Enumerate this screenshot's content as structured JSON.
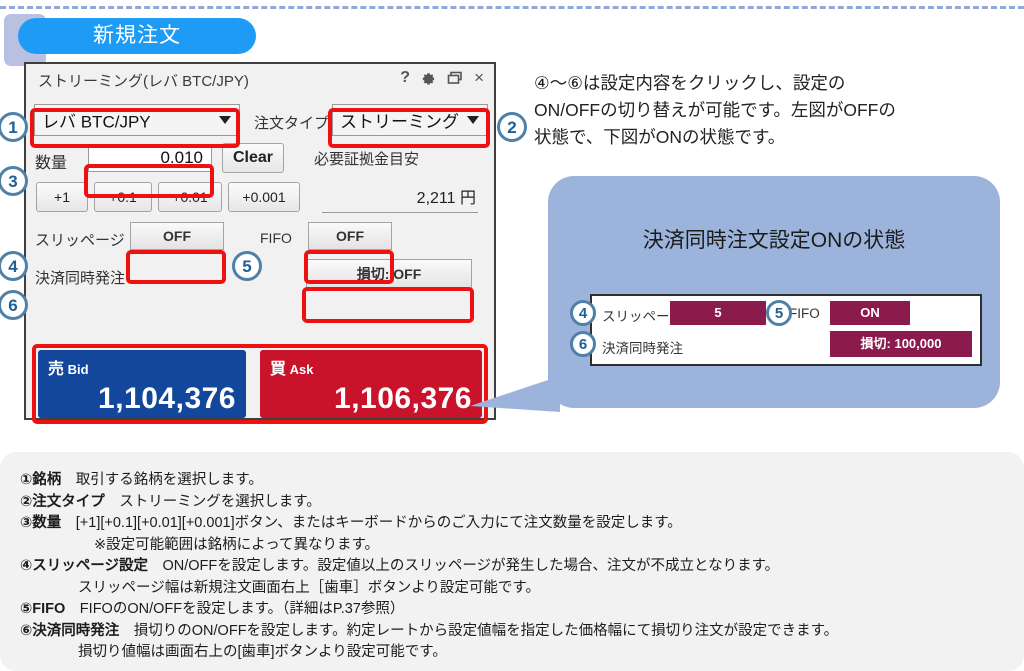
{
  "colors": {
    "accent_blue": "#1e9cf5",
    "bubble_blue": "#9cb4dc",
    "bid_blue": "#13479b",
    "ask_red": "#c9132b",
    "highlight_red": "#ee1111",
    "on_value_magenta": "#8c1b4d",
    "callout_circle_border": "#4f81a8",
    "dashed_rule": "#8fa8d8",
    "legend_bg": "#f2f2f2"
  },
  "section_tab": {
    "label": "新規注文"
  },
  "order_window": {
    "title": "ストリーミング(レバ BTC/JPY)",
    "titlebar_buttons": [
      {
        "name": "help-icon",
        "glyph": "?"
      },
      {
        "name": "gear-icon",
        "glyph": "⚙"
      },
      {
        "name": "restore-window-icon",
        "glyph": "❐"
      },
      {
        "name": "close-icon",
        "glyph": "×"
      }
    ],
    "symbol_select": {
      "value": "レバ BTC/JPY"
    },
    "order_type": {
      "label": "注文タイプ",
      "value": "ストリーミング"
    },
    "quantity": {
      "label": "数量",
      "value": "0.010",
      "clear_label": "Clear",
      "step_buttons": [
        "+1",
        "+0.1",
        "+0.01",
        "+0.001"
      ]
    },
    "margin": {
      "label": "必要証拠金目安",
      "value": "2,211",
      "unit": "円"
    },
    "slippage": {
      "label": "スリッページ",
      "value": "OFF"
    },
    "fifo": {
      "label": "FIFO",
      "value": "OFF"
    },
    "settle_simultaneous": {
      "label": "決済同時発注",
      "value": "損切: OFF"
    },
    "rates": {
      "bid": {
        "jp": "売",
        "en": "Bid",
        "price": "1,104,376"
      },
      "ask": {
        "jp": "買",
        "en": "Ask",
        "price": "1,106,376"
      }
    }
  },
  "callout_numbers": {
    "n1": "1",
    "n2": "2",
    "n3": "3",
    "n4": "4",
    "n5": "5",
    "n6": "6"
  },
  "description": {
    "line1": "④～⑥は設定内容をクリックし、設定の",
    "line2": "ON/OFFの切り替えが可能です。左図がOFFの",
    "line3": "状態で、下図がONの状態です。"
  },
  "bubble": {
    "title": "決済同時注文設定ONの状態",
    "on_panel": {
      "slippage": {
        "label": "スリッページ",
        "value": "5"
      },
      "fifo": {
        "label": "FIFO",
        "value": "ON"
      },
      "settle_simultaneous": {
        "label": "決済同時発注",
        "value": "損切: 100,000"
      },
      "numbers": {
        "n4": "4",
        "n5": "5",
        "n6": "6"
      }
    }
  },
  "legend": {
    "lines": [
      {
        "marker": "①",
        "bold": "銘柄",
        "text": "　取引する銘柄を選択します。",
        "indent": 0
      },
      {
        "marker": "②",
        "bold": "注文タイプ",
        "text": "　ストリーミングを選択します。",
        "indent": 0
      },
      {
        "marker": "③",
        "bold": "数量",
        "text": "　[+1][+0.1][+0.01][+0.001]ボタン、またはキーボードからのご入力にて注文数量を設定します。",
        "indent": 0
      },
      {
        "marker": "",
        "bold": "",
        "text": "※設定可能範囲は銘柄によって異なります。",
        "indent": 1
      },
      {
        "marker": "④",
        "bold": "スリッページ設定",
        "text": "　ON/OFFを設定します。設定値以上のスリッページが発生した場合、注文が不成立となります。",
        "indent": 0
      },
      {
        "marker": "",
        "bold": "",
        "text": "スリッページ幅は新規注文画面右上［歯車］ボタンより設定可能です。",
        "indent": 2
      },
      {
        "marker": "⑤",
        "bold": "FIFO",
        "text": "　FIFOのON/OFFを設定します。（詳細はP.37参照）",
        "indent": 0
      },
      {
        "marker": "⑥",
        "bold": "決済同時発注",
        "text": "　損切りのON/OFFを設定します。約定レートから設定値幅を指定した価格幅にて損切り注文が設定できます。",
        "indent": 0
      },
      {
        "marker": "",
        "bold": "",
        "text": "損切り値幅は画面右上の[歯車]ボタンより設定可能です。",
        "indent": 2
      }
    ]
  }
}
